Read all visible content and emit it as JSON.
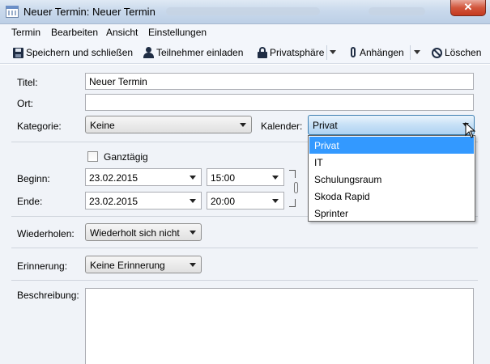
{
  "window": {
    "title": "Neuer Termin: Neuer Termin",
    "close_label": "✕"
  },
  "menu": {
    "items": [
      "Termin",
      "Bearbeiten",
      "Ansicht",
      "Einstellungen"
    ]
  },
  "toolbar": {
    "save_label": "Speichern und schließen",
    "invite_label": "Teilnehmer einladen",
    "privacy_label": "Privatsphäre",
    "attach_label": "Anhängen",
    "delete_label": "Löschen"
  },
  "form": {
    "title_label": "Titel:",
    "title_value": "Neuer Termin",
    "location_label": "Ort:",
    "location_value": "",
    "category_label": "Kategorie:",
    "category_value": "Keine",
    "calendar_label": "Kalender:",
    "calendar_value": "Privat",
    "calendar_options": [
      "Privat",
      "IT",
      "Schulungsraum",
      "Skoda Rapid",
      "Sprinter"
    ],
    "allday_label": "Ganztägig",
    "allday_checked": false,
    "start_label": "Beginn:",
    "start_date": "23.02.2015",
    "start_time": "15:00",
    "end_label": "Ende:",
    "end_date": "23.02.2015",
    "end_time": "20:00",
    "repeat_label": "Wiederholen:",
    "repeat_value": "Wiederholt sich nicht",
    "reminder_label": "Erinnerung:",
    "reminder_value": "Keine Erinnerung",
    "description_label": "Beschreibung:",
    "description_value": ""
  },
  "colors": {
    "selected_option_bg": "#3399ff",
    "close_button": "#c43a1f"
  }
}
